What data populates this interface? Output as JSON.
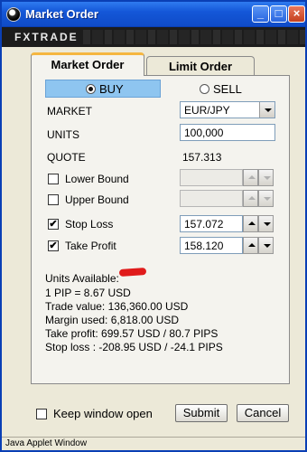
{
  "window": {
    "title": "Market Order",
    "brand": "FXTrade",
    "title_icon": "fxtrade-globe-icon",
    "controls": {
      "minimize": "_",
      "maximize": "□",
      "close": "×"
    }
  },
  "tabs": [
    {
      "label": "Market Order",
      "active": true
    },
    {
      "label": "Limit Order",
      "active": false
    }
  ],
  "side": {
    "buy_label": "BUY",
    "sell_label": "SELL",
    "selected": "BUY"
  },
  "form": {
    "market_label": "MARKET",
    "market_value": "EUR/JPY",
    "units_label": "UNITS",
    "units_value": "100,000",
    "quote_label": "QUOTE",
    "quote_value": "157.313",
    "lower_bound_label": "Lower Bound",
    "lower_bound_checked": false,
    "lower_bound_value": "",
    "upper_bound_label": "Upper Bound",
    "upper_bound_checked": false,
    "upper_bound_value": "",
    "stop_loss_label": "Stop Loss",
    "stop_loss_checked": true,
    "stop_loss_value": "157.072",
    "take_profit_label": "Take Profit",
    "take_profit_checked": true,
    "take_profit_value": "158.120"
  },
  "info": {
    "units_available": "Units Available:",
    "pip": "1 PIP = 8.67 USD",
    "trade_value": "Trade value: 136,360.00 USD",
    "margin_used": "Margin used: 6,818.00 USD",
    "take_profit": "Take profit: 699.57 USD / 80.7 PIPS",
    "stop_loss": "Stop loss : -208.95 USD / -24.1 PIPS"
  },
  "footer": {
    "keep_open_label": "Keep window open",
    "keep_open_checked": false,
    "submit_label": "Submit",
    "cancel_label": "Cancel"
  },
  "status": "Java Applet Window",
  "colors": {
    "titlebar": "#1457d8",
    "buy_highlight": "#8ec5f0",
    "active_tab_accent": "#f5b640",
    "redaction": "#e01b1b"
  }
}
